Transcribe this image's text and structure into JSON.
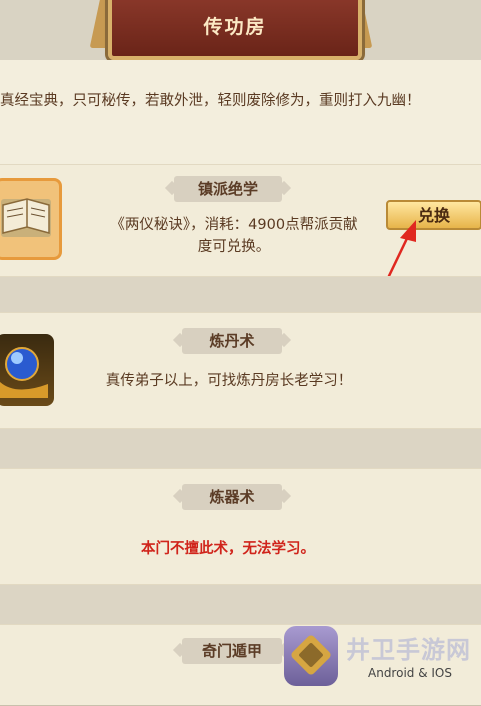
{
  "header": {
    "title": "传功房"
  },
  "intro": {
    "text": "真经宝典，只可秘传，若敢外泄，轻则废除修为，重则打入九幽！"
  },
  "sections": [
    {
      "label": "镇派绝学",
      "description": "《两仪秘诀》，消耗：4900点帮派贡献度可兑换。",
      "action": "兑换"
    },
    {
      "label": "炼丹术",
      "description": "真传弟子以上，可找炼丹房长老学习！"
    },
    {
      "label": "炼器术",
      "description": "本门不擅此术，无法学习。"
    },
    {
      "label": "奇门遁甲"
    }
  ],
  "watermark": {
    "site": "井卫手游网",
    "platform": "Android & IOS"
  },
  "colors": {
    "warning": "#d0241b",
    "accent": "#e7b44a",
    "banner": "#8e3a2c"
  }
}
